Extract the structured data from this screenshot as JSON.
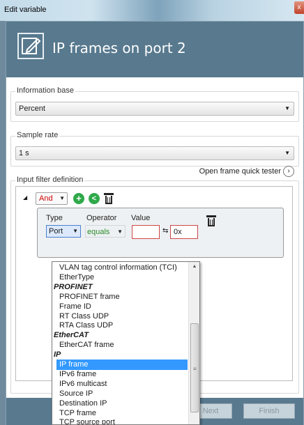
{
  "window": {
    "title": "Edit variable",
    "close_glyph": "x"
  },
  "header": {
    "title": "IP frames on port 2",
    "icon": "edit-document-icon"
  },
  "information_base": {
    "label": "Information base",
    "value": "Percent"
  },
  "sample_rate": {
    "label": "Sample rate",
    "value": "1 s"
  },
  "filter": {
    "label": "Input filter definition",
    "open_tester": "Open frame quick tester",
    "logic_operator": "And",
    "condition": {
      "type_label": "Type",
      "operator_label": "Operator",
      "value_label": "Value",
      "type_value": "Port",
      "operator_value": "equals",
      "value_hex": "0x"
    }
  },
  "dropdown": {
    "items": [
      {
        "text": "VLAN tag control information (TCI)",
        "kind": "item"
      },
      {
        "text": "EtherType",
        "kind": "item"
      },
      {
        "text": "PROFINET",
        "kind": "group"
      },
      {
        "text": "PROFINET frame",
        "kind": "item"
      },
      {
        "text": "Frame ID",
        "kind": "item"
      },
      {
        "text": "RT Class UDP",
        "kind": "item"
      },
      {
        "text": "RTA Class UDP",
        "kind": "item"
      },
      {
        "text": "EtherCAT",
        "kind": "group"
      },
      {
        "text": "EtherCAT frame",
        "kind": "item"
      },
      {
        "text": "IP",
        "kind": "group"
      },
      {
        "text": "IP frame",
        "kind": "selected"
      },
      {
        "text": "IPv6 frame",
        "kind": "item"
      },
      {
        "text": "IPv6 multicast",
        "kind": "item"
      },
      {
        "text": "Source IP",
        "kind": "item"
      },
      {
        "text": "Destination IP",
        "kind": "item"
      },
      {
        "text": "TCP frame",
        "kind": "item"
      },
      {
        "text": "TCP source port",
        "kind": "item"
      }
    ]
  },
  "footer": {
    "next": "Next",
    "finish": "Finish"
  }
}
